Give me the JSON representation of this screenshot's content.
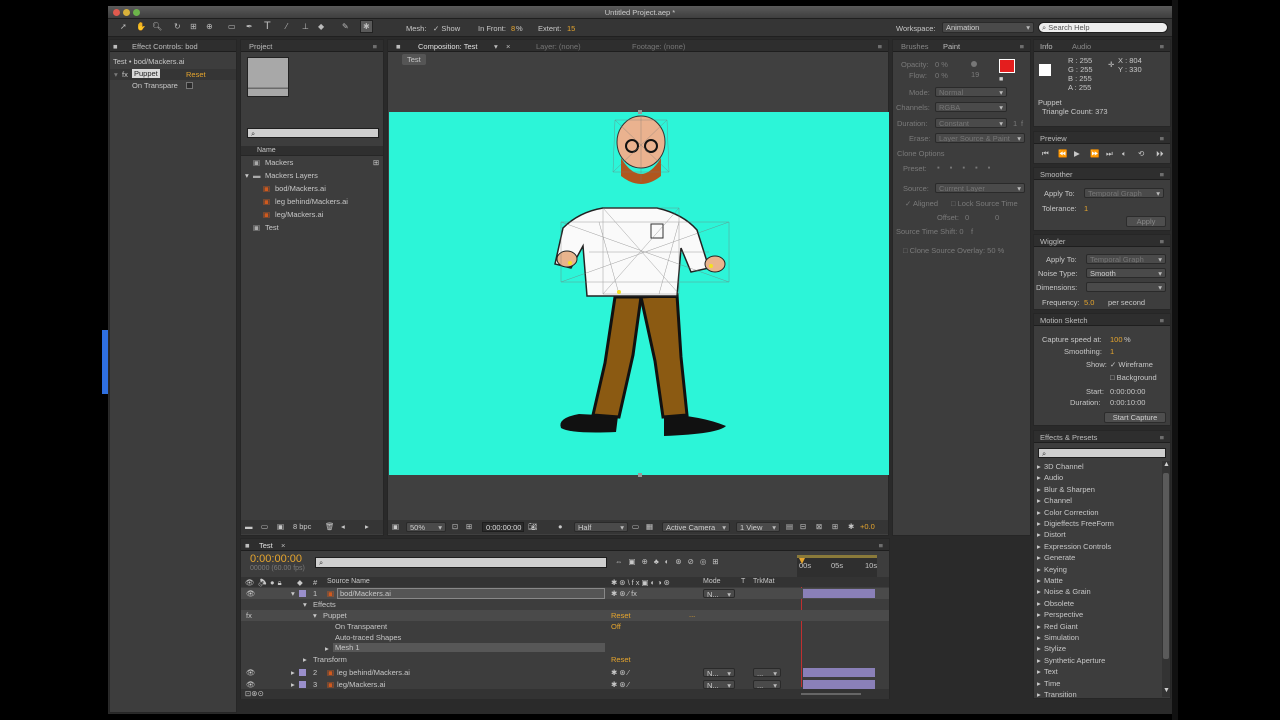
{
  "window": {
    "title": "Untitled Project.aep *"
  },
  "toolbar": {
    "mesh_label": "Mesh:",
    "show_label": "Show",
    "in_front_label": "In Front:",
    "in_front_value": "8",
    "in_front_unit": "%",
    "extent_label": "Extent:",
    "extent_value": "15",
    "workspace_label": "Workspace:",
    "workspace_value": "Animation",
    "search_placeholder": "Search Help"
  },
  "effect_controls": {
    "tab": "Effect Controls: bod",
    "layer_path": "Test • bod/Mackers.ai",
    "effect_name": "Puppet",
    "reset_label": "Reset",
    "fx_label": "fx",
    "option": "On Transpare"
  },
  "project": {
    "tab": "Project",
    "name_header": "Name",
    "items": [
      {
        "name": "Mackers",
        "kind": "comp"
      },
      {
        "name": "Mackers Layers",
        "kind": "folder"
      },
      {
        "name": "bod/Mackers.ai",
        "kind": "ai"
      },
      {
        "name": "leg behind/Mackers.ai",
        "kind": "ai"
      },
      {
        "name": "leg/Mackers.ai",
        "kind": "ai"
      },
      {
        "name": "Test",
        "kind": "comp"
      }
    ],
    "bpc": "8 bpc"
  },
  "composition": {
    "tab": "Composition: Test",
    "layer_tab": "Layer: (none)",
    "footage_tab": "Footage: (none)",
    "comp_name": "Test",
    "bg_color": "#2cf5d8",
    "zoom": "50%",
    "timecode": "0:00:00:00",
    "resolution": "Half",
    "camera": "Active Camera",
    "view": "1 View",
    "exposure": "+0.0"
  },
  "paint": {
    "tabs": [
      "Brushes",
      "Paint"
    ],
    "opacity_label": "Opacity:",
    "opacity_value": "0 %",
    "flow_label": "Flow:",
    "flow_value": "0 %",
    "brush_size": "19",
    "mode_label": "Mode:",
    "mode_value": "Normal",
    "channels_label": "Channels:",
    "channels_value": "RGBA",
    "duration_label": "Duration:",
    "duration_value": "Constant",
    "duration_frames": "1",
    "frames_unit": "f",
    "erase_label": "Erase:",
    "erase_value": "Layer Source & Paint",
    "clone_options": "Clone Options",
    "preset_label": "Preset:",
    "source_label": "Source:",
    "source_value": "Current Layer",
    "aligned": "Aligned",
    "lock_source": "Lock Source Time",
    "offset_label": "Offset:",
    "offset_x": "0",
    "offset_y": "0",
    "source_time_shift": "Source Time Shift: 0",
    "clone_overlay": "Clone Source Overlay: 50 %",
    "fg_color": "#e41e1e"
  },
  "info": {
    "tabs": [
      "Info",
      "Audio"
    ],
    "r": "R : 255",
    "g": "G : 255",
    "b": "B : 255",
    "a": "A : 255",
    "x": "X : 804",
    "y": "Y : 330",
    "tool": "Puppet",
    "triangles": "Triangle Count: 373"
  },
  "preview": {
    "tab": "Preview"
  },
  "smoother": {
    "tab": "Smoother",
    "apply_to_label": "Apply To:",
    "apply_to_value": "Temporal Graph",
    "tolerance_label": "Tolerance:",
    "tolerance_value": "1",
    "apply_button": "Apply"
  },
  "wiggler": {
    "tab": "Wiggler",
    "apply_to_label": "Apply To:",
    "apply_to_value": "Temporal Graph",
    "noise_label": "Noise Type:",
    "noise_value": "Smooth",
    "dimensions_label": "Dimensions:",
    "frequency_label": "Frequency:",
    "frequency_value": "5.0",
    "frequency_unit": "per second"
  },
  "motion_sketch": {
    "tab": "Motion Sketch",
    "capture_label": "Capture speed at:",
    "capture_value": "100",
    "capture_unit": "%",
    "smoothing_label": "Smoothing:",
    "smoothing_value": "1",
    "show_label": "Show:",
    "wireframe": "Wireframe",
    "background": "Background",
    "start_label": "Start:",
    "start_value": "0:00:00:00",
    "duration_label": "Duration:",
    "duration_value": "0:00:10:00",
    "capture_button": "Start Capture"
  },
  "effects_presets": {
    "tab": "Effects & Presets",
    "items": [
      "3D Channel",
      "Audio",
      "Blur & Sharpen",
      "Channel",
      "Color Correction",
      "Digieffects FreeForm",
      "Distort",
      "Expression Controls",
      "Generate",
      "Keying",
      "Matte",
      "Noise & Grain",
      "Obsolete",
      "Perspective",
      "Red Giant",
      "Simulation",
      "Stylize",
      "Synthetic Aperture",
      "Text",
      "Time",
      "Transition"
    ]
  },
  "timeline": {
    "tab": "Test",
    "timecode": "0:00:00:00",
    "fps": "00000 (60.00 fps)",
    "col_num": "#",
    "col_source": "Source Name",
    "col_mode": "Mode",
    "col_t": "T",
    "col_trkmat": "TrkMat",
    "ruler": [
      "00s",
      "05s",
      "10s"
    ],
    "layers": [
      {
        "num": "1",
        "name": "bod/Mackers.ai",
        "mode": "N...",
        "trk": ""
      },
      {
        "num": "2",
        "name": "leg behind/Mackers.ai",
        "mode": "N...",
        "trk": "..."
      },
      {
        "num": "3",
        "name": "leg/Mackers.ai",
        "mode": "N...",
        "trk": "..."
      }
    ],
    "effects_label": "Effects",
    "puppet_label": "Puppet",
    "on_transparent_label": "On Transparent",
    "on_transparent_value": "Off",
    "auto_traced": "Auto-traced Shapes",
    "mesh_label": "Mesh 1",
    "transform_label": "Transform",
    "reset_label": "Reset",
    "fx_label": "fx",
    "ellipsis": "..."
  }
}
